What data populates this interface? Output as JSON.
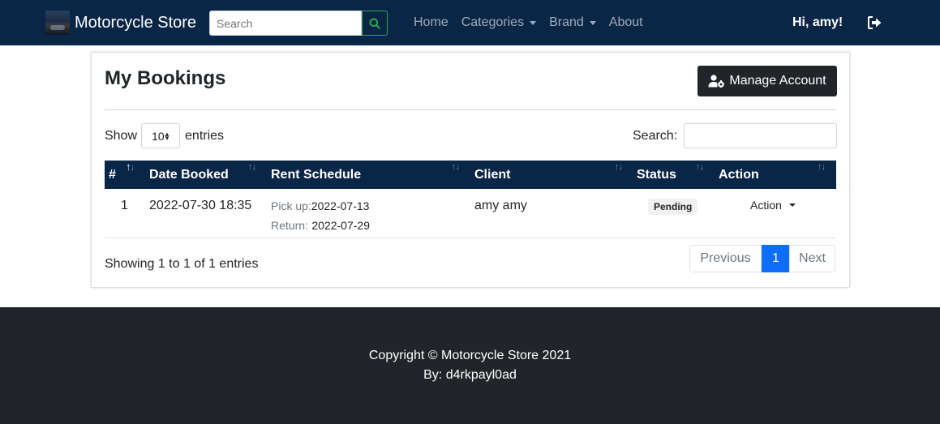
{
  "navbar": {
    "brand": "Motorcycle Store",
    "search_placeholder": "Search",
    "links": [
      "Home",
      "Categories",
      "Brand",
      "About"
    ],
    "greeting": "Hi, amy!"
  },
  "colors": {
    "navbar_bg": "#0a2647",
    "table_header_bg": "#0a2647",
    "footer_bg": "#212529",
    "pager_active": "#0d6efd"
  },
  "page": {
    "title": "My Bookings",
    "manage_account": "Manage Account",
    "length": {
      "show": "Show",
      "value": "10",
      "entries": "entries"
    },
    "search_label": "Search:",
    "table": {
      "headers": [
        "#",
        "Date Booked",
        "Rent Schedule",
        "Client",
        "Status",
        "Action"
      ],
      "rows": [
        {
          "num": "1",
          "date_booked": "2022-07-30 18:35",
          "pickup_label": "Pick up:",
          "pickup": "2022-07-13",
          "return_label": "Return:",
          "return": "2022-07-29",
          "client": "amy amy",
          "status": "Pending",
          "action": "Action"
        }
      ]
    },
    "info": "Showing 1 to 1 of 1 entries",
    "pager": {
      "previous": "Previous",
      "current": "1",
      "next": "Next"
    }
  },
  "footer": {
    "copyright": "Copyright © Motorcycle Store 2021",
    "by": "By: d4rkpayl0ad"
  },
  "icons": {
    "search": "search-icon",
    "logout": "logout-icon",
    "manage": "user-gear-icon"
  }
}
